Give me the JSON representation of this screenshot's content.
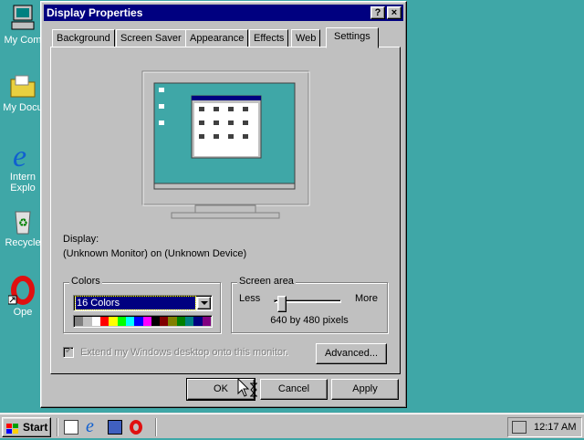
{
  "desktop": {
    "icons": [
      {
        "name": "my-computer",
        "label": "My Com"
      },
      {
        "name": "my-documents",
        "label": "My Docu"
      },
      {
        "name": "internet-explorer",
        "label": "Intern Explo"
      },
      {
        "name": "recycle-bin",
        "label": "Recycle"
      },
      {
        "name": "opera",
        "label": "Ope"
      }
    ]
  },
  "window": {
    "title": "Display Properties",
    "help_button": "?",
    "close_button": "×",
    "tabs": [
      "Background",
      "Screen Saver",
      "Appearance",
      "Effects",
      "Web",
      "Settings"
    ],
    "active_tab": "Settings",
    "display_label": "Display:",
    "display_value": "(Unknown Monitor) on (Unknown Device)",
    "colors": {
      "group_label": "Colors",
      "selected": "16 Colors",
      "palette": [
        "#808080",
        "#c0c0c0",
        "#ffffff",
        "#ff0000",
        "#ffff00",
        "#00ff00",
        "#00ffff",
        "#0000ff",
        "#ff00ff",
        "#000000",
        "#800000",
        "#808000",
        "#008000",
        "#008080",
        "#000080",
        "#800080"
      ]
    },
    "screen_area": {
      "group_label": "Screen area",
      "less_label": "Less",
      "more_label": "More",
      "value_label": "640 by 480 pixels",
      "slider_level": 0
    },
    "extend_checkbox_label": "Extend my Windows desktop onto this monitor.",
    "advanced_button": "Advanced...",
    "ok_button": "OK",
    "cancel_button": "Cancel",
    "apply_button": "Apply"
  },
  "taskbar": {
    "start_label": "Start",
    "clock": "12:17 AM"
  },
  "colors": {
    "desktop": "#3fa7a7",
    "titlebar": "#000080",
    "face": "#c0c0c0",
    "selection": "#000080"
  }
}
